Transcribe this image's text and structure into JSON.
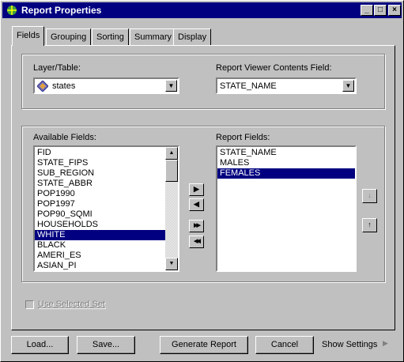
{
  "window": {
    "title": "Report Properties",
    "minimize": "_",
    "maximize": "□",
    "close": "×"
  },
  "tabs": [
    "Fields",
    "Grouping",
    "Sorting",
    "Summary",
    "Display"
  ],
  "layer": {
    "label": "Layer/Table:",
    "value": "states"
  },
  "viewer_field": {
    "label": "Report Viewer Contents Field:",
    "value": "STATE_NAME"
  },
  "available": {
    "label": "Available Fields:",
    "items": [
      "FID",
      "STATE_FIPS",
      "SUB_REGION",
      "STATE_ABBR",
      "POP1990",
      "POP1997",
      "POP90_SQMI",
      "HOUSEHOLDS",
      "WHITE",
      "BLACK",
      "AMERI_ES",
      "ASIAN_PI"
    ],
    "selected_index": 8
  },
  "report": {
    "label": "Report Fields:",
    "items": [
      "STATE_NAME",
      "MALES",
      "FEMALES"
    ],
    "selected_index": 2
  },
  "move_buttons": {
    "add": "▶",
    "remove": "◀",
    "add_all": "▶▶",
    "remove_all": "◀◀"
  },
  "order_buttons": {
    "down": "↓",
    "up": "↑"
  },
  "use_selected": "Use Selected Set",
  "buttons": {
    "load": "Load...",
    "save": "Save...",
    "generate": "Generate Report",
    "cancel": "Cancel"
  },
  "show_settings": "Show Settings"
}
